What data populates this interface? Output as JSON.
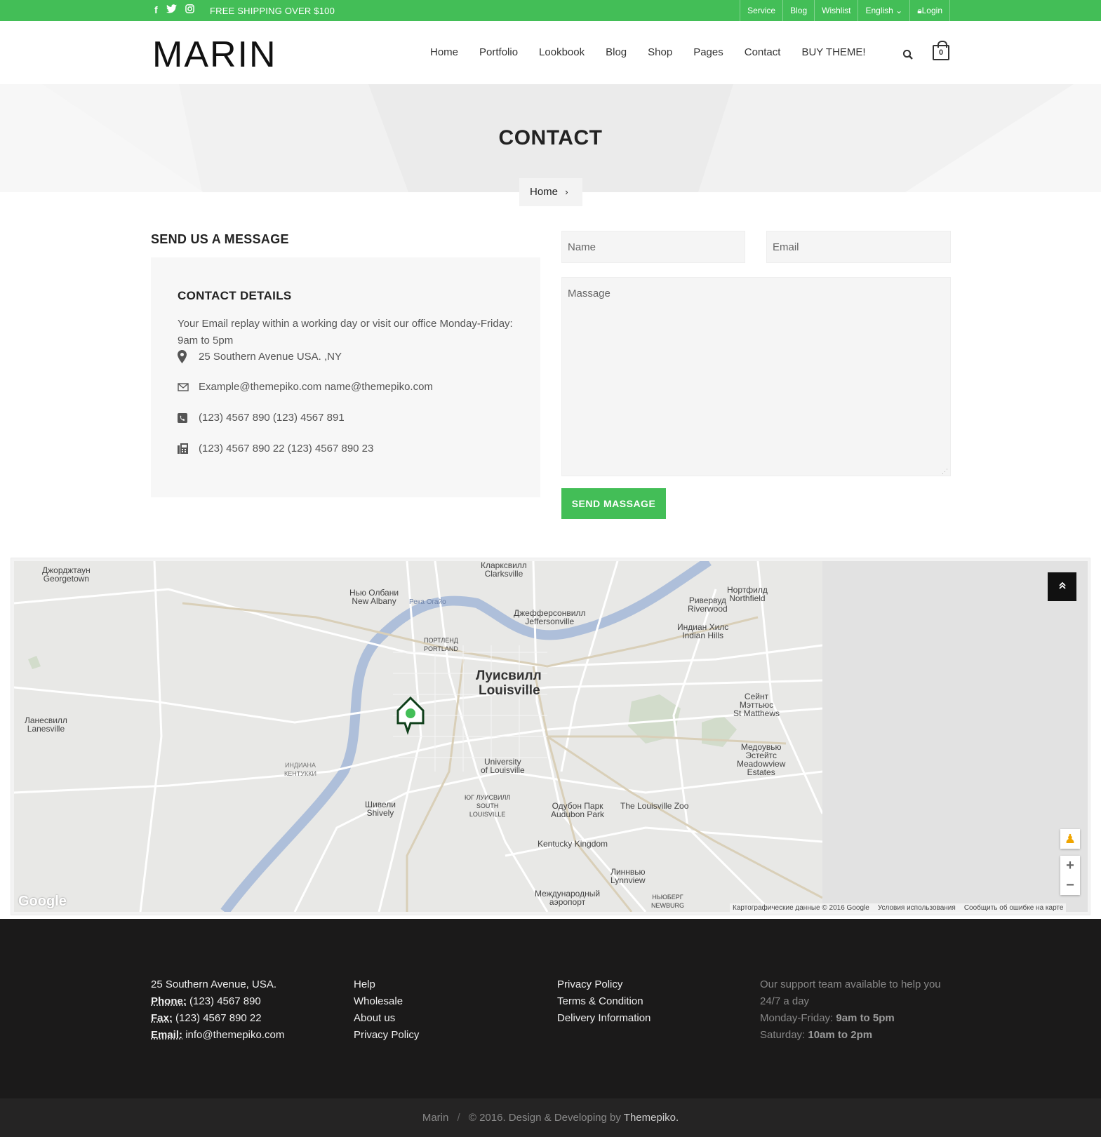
{
  "topbar": {
    "social_icons": [
      "facebook-icon",
      "twitter-icon",
      "instagram-icon"
    ],
    "shipping_text": "FREE SHIPPING OVER $100",
    "links": [
      "Service",
      "Blog",
      "Wishlist"
    ],
    "language": "English",
    "login": "Login"
  },
  "header": {
    "logo": "MARIN",
    "nav": [
      "Home",
      "Portfolio",
      "Lookbook",
      "Blog",
      "Shop",
      "Pages",
      "Contact",
      "BUY THEME!"
    ],
    "cart_count": "0"
  },
  "banner": {
    "title": "CONTACT",
    "breadcrumb": "Home"
  },
  "contact": {
    "section_title": "SEND US A MESSAGE",
    "details_title": "CONTACT DETAILS",
    "intro": "Your Email replay within a working day or visit our office Monday-Friday: 9am to 5pm",
    "address": "25 Southern Avenue USA. ,NY",
    "emails": "Example@themepiko.com name@themepiko.com",
    "phones": "(123) 4567 890 (123) 4567 891",
    "fax": "(123) 4567 890 22 (123) 4567 890 23"
  },
  "form": {
    "name_placeholder": "Name",
    "email_placeholder": "Email",
    "message_placeholder": "Massage",
    "submit_label": "SEND MASSAGE"
  },
  "map": {
    "labels": {
      "georgetown": "Джорджтаун\nGeorgetown",
      "clarksville": "Кларксвилл\nClarksville",
      "new_albany": "Нью Олбани\nNew Albany",
      "jeffersonville": "Джефферсонвилл\nJeffersonville",
      "riverwood": "Ривервуд\nRiverwood",
      "northfield": "Нортфилд\nNorthfield",
      "indian_hills": "Индиан Хилс\nIndian Hills",
      "louisville_ru": "Луисвилл",
      "louisville_en": "Louisville",
      "lanesville": "Ланесвилл\nLanesville",
      "st_matthews": "Сейнт\nМэттьюс\nSt Matthews",
      "meadowview": "Медоувью\nЭстейтс\nMeadowview\nEstates",
      "portland": "ПОРТЛЕНД\nPORTLAND",
      "university": "University\nof Louisville",
      "south_louisville": "ЮГ ЛУИСВИЛЛ\nSOUTH\nLOUISVILLE",
      "audubon": "Одубон Парк\nAudubon Park",
      "zoo": "The Louisville Zoo",
      "shively": "Шивели\nShively",
      "kentucky_kingdom": "Kentucky Kingdom",
      "lynnview": "Линнвью\nLynnview",
      "airport": "Международный\nаэропорт",
      "newburg": "НЬЮБЕРГ\nNEWBURG",
      "river": "Река Огайо",
      "indiana_kentucky": "ИНДИАНА\nКЕНТУККИ"
    },
    "google": "Google",
    "attribution": [
      "Картографические данные © 2016 Google",
      "Условия использования",
      "Сообщить об ошибке на карте"
    ]
  },
  "footer": {
    "address": "25 Southern Avenue, USA.",
    "phone_label": "Phone:",
    "phone": "(123) 4567 890",
    "fax_label": "Fax:",
    "fax": "(123) 4567 890 22",
    "email_label": "Email:",
    "email": "info@themepiko.com",
    "col2": [
      "Help",
      "Wholesale",
      "About us",
      "Privacy Policy"
    ],
    "col3": [
      "Privacy Policy",
      "Terms & Condition",
      "Delivery Information"
    ],
    "support_text": "Our support team available to help you 24/7 a day",
    "weekday_label": "Monday-Friday:",
    "weekday_hours": "9am to 5pm",
    "saturday_label": "Saturday:",
    "saturday_hours": "10am to 2pm"
  },
  "copyright": {
    "brand": "Marin",
    "sep": "/",
    "text": "© 2016. Design & Developing by",
    "author": "Themepiko."
  },
  "colors": {
    "accent": "#43be57",
    "footer_bg": "#1b1a1a",
    "copyright_bg": "#252424"
  }
}
